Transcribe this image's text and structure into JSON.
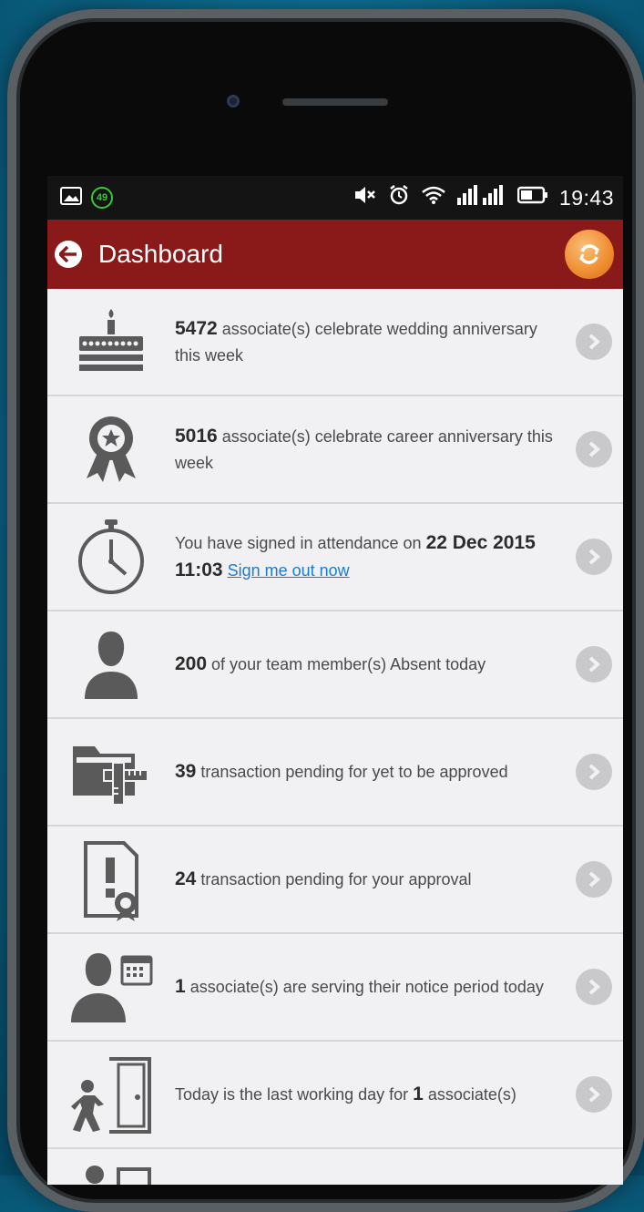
{
  "status_bar": {
    "notification_count": "49",
    "time": "19:43",
    "icons": [
      "image-icon",
      "mute-icon",
      "alarm-icon",
      "wifi-icon",
      "signal-icon",
      "battery-icon"
    ]
  },
  "app_bar": {
    "title": "Dashboard",
    "back_icon": "back-arrow-icon",
    "refresh_icon": "refresh-icon",
    "bar_color": "#8a1a1a",
    "refresh_color": "#ef8c30"
  },
  "items": [
    {
      "icon": "cake-icon",
      "bold": "5472",
      "text": " associate(s) celebrate wedding anniversary this week"
    },
    {
      "icon": "award-ribbon-icon",
      "bold": "5016",
      "text": " associate(s) celebrate career anniversary this week"
    },
    {
      "icon": "stopwatch-icon",
      "pre": "You have signed in attendance on ",
      "bold": "22 Dec 2015 11:03",
      "link": "Sign me out now"
    },
    {
      "icon": "person-icon",
      "bold": "200",
      "text": " of your team member(s) Absent today"
    },
    {
      "icon": "folder-ruler-icon",
      "bold": "39",
      "text": " transaction pending for yet to be approved"
    },
    {
      "icon": "document-alert-icon",
      "bold": "24",
      "text": " transaction pending for your approval"
    },
    {
      "icon": "person-calendar-icon",
      "bold": "1",
      "text": " associate(s) are serving their notice period today"
    },
    {
      "icon": "exit-door-icon",
      "pre": "Today is the last working day for ",
      "bold": "1",
      "text": " associate(s)"
    },
    {
      "icon": "partial-row-icon",
      "bold": "",
      "text": ""
    }
  ]
}
